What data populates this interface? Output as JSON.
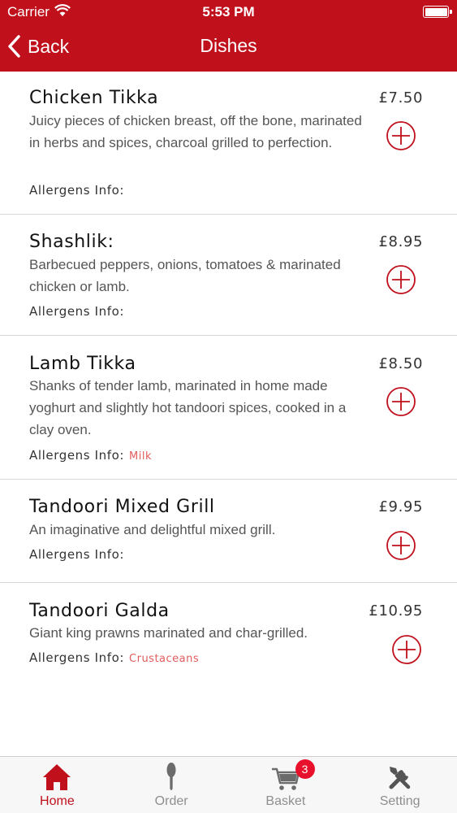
{
  "status_bar": {
    "carrier": "Carrier",
    "time": "5:53 PM",
    "wifi_icon": "wifi-icon",
    "battery_icon": "battery-icon"
  },
  "nav": {
    "back_label": "Back",
    "title": "Dishes",
    "back_icon": "chevron-left-icon"
  },
  "colors": {
    "brand": "#c0101c",
    "allergen": "#e25c5c",
    "badge": "#e8102a",
    "inactive_tab": "#8e8e8e"
  },
  "dishes": [
    {
      "name": "Chicken Tikka",
      "price": "£7.50",
      "description": "Juicy pieces of chicken breast, off the bone, marinated in herbs and spices, charcoal grilled to perfection.",
      "allergens_label": "Allergens Info:",
      "allergens": ""
    },
    {
      "name": "Shashlik:",
      "price": "£8.95",
      "description": "Barbecued peppers, onions, tomatoes & marinated chicken or lamb.",
      "allergens_label": "Allergens Info:",
      "allergens": ""
    },
    {
      "name": "Lamb Tikka",
      "price": "£8.50",
      "description": "Shanks of tender lamb, marinated in home made yoghurt and slightly hot tandoori spices, cooked in a clay oven.",
      "allergens_label": "Allergens Info:",
      "allergens": "Milk"
    },
    {
      "name": "Tandoori Mixed Grill",
      "price": "£9.95",
      "description": "An imaginative and delightful mixed grill.",
      "allergens_label": "Allergens Info:",
      "allergens": ""
    },
    {
      "name": "Tandoori Galda",
      "price": "£10.95",
      "description": "Giant king prawns marinated and char-grilled.",
      "allergens_label": "Allergens Info:",
      "allergens": "Crustaceans"
    }
  ],
  "tabs": [
    {
      "label": "Home",
      "icon": "home-icon",
      "active": true
    },
    {
      "label": "Order",
      "icon": "spoon-icon",
      "active": false
    },
    {
      "label": "Basket",
      "icon": "cart-icon",
      "active": false,
      "badge": "3"
    },
    {
      "label": "Setting",
      "icon": "tools-icon",
      "active": false
    }
  ]
}
